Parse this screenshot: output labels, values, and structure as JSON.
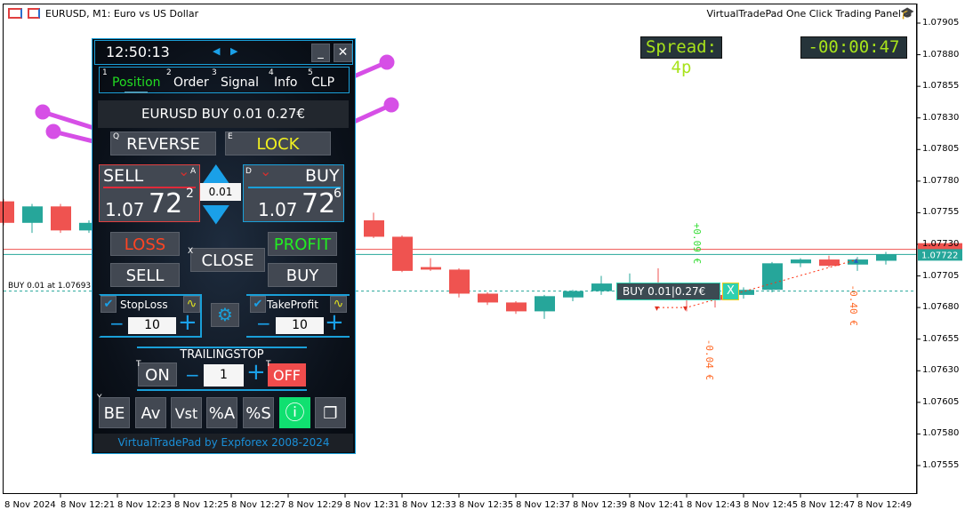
{
  "window": {
    "title": "EURUSD, M1:  Euro vs US Dollar",
    "panel_title": "VirtualTradePad One Click Trading Panel"
  },
  "indicators": {
    "spread": "Spread: 4p",
    "timer": "-00:00:47"
  },
  "colors": {
    "bull": "#26a69a",
    "bear": "#ef5350",
    "accent": "#1a9fd8",
    "lcd_text": "#a8e31b",
    "arrow": "#d64fe6"
  },
  "chart_data": {
    "type": "candlestick",
    "symbol": "EURUSD",
    "timeframe": "M1",
    "ylim": [
      1.07545,
      1.07915
    ],
    "price_ticks": [
      "1.07905",
      "1.07880",
      "1.07855",
      "1.07830",
      "1.07805",
      "1.07780",
      "1.07755",
      "1.07730",
      "1.07705",
      "1.07680",
      "1.07655",
      "1.07630",
      "1.07605",
      "1.07580",
      "1.07555"
    ],
    "time_ticks": [
      "8 Nov 2024",
      "8 Nov 12:21",
      "8 Nov 12:23",
      "8 Nov 12:25",
      "8 Nov 12:27",
      "8 Nov 12:29",
      "8 Nov 12:31",
      "8 Nov 12:33",
      "8 Nov 12:35",
      "8 Nov 12:37",
      "8 Nov 12:39",
      "8 Nov 12:41",
      "8 Nov 12:43",
      "8 Nov 12:45",
      "8 Nov 12:47",
      "8 Nov 12:49"
    ],
    "candles": [
      {
        "t": "12:19",
        "o": 1.07764,
        "h": 1.07766,
        "l": 1.07745,
        "c": 1.07747
      },
      {
        "t": "12:20",
        "o": 1.07747,
        "h": 1.07762,
        "l": 1.07739,
        "c": 1.0776
      },
      {
        "t": "12:21",
        "o": 1.0776,
        "h": 1.07762,
        "l": 1.07739,
        "c": 1.07741
      },
      {
        "t": "12:22",
        "o": 1.07741,
        "h": 1.07749,
        "l": 1.07739,
        "c": 1.07747
      },
      {
        "t": "12:32",
        "o": 1.07749,
        "h": 1.07755,
        "l": 1.07735,
        "c": 1.07736
      },
      {
        "t": "12:33",
        "o": 1.07736,
        "h": 1.07737,
        "l": 1.07708,
        "c": 1.07709
      },
      {
        "t": "12:34",
        "o": 1.07712,
        "h": 1.07719,
        "l": 1.07709,
        "c": 1.0771
      },
      {
        "t": "12:35",
        "o": 1.0771,
        "h": 1.07711,
        "l": 1.07688,
        "c": 1.07691
      },
      {
        "t": "12:36",
        "o": 1.07691,
        "h": 1.07692,
        "l": 1.07682,
        "c": 1.07684
      },
      {
        "t": "12:37",
        "o": 1.07684,
        "h": 1.07685,
        "l": 1.07675,
        "c": 1.07677
      },
      {
        "t": "12:38",
        "o": 1.07677,
        "h": 1.0769,
        "l": 1.07671,
        "c": 1.07689
      },
      {
        "t": "12:39",
        "o": 1.07688,
        "h": 1.07694,
        "l": 1.07685,
        "c": 1.07693
      },
      {
        "t": "12:40",
        "o": 1.07693,
        "h": 1.07705,
        "l": 1.0769,
        "c": 1.07699
      },
      {
        "t": "12:41",
        "o": 1.07696,
        "h": 1.07707,
        "l": 1.07692,
        "c": 1.07699
      },
      {
        "t": "12:42",
        "o": 1.07699,
        "h": 1.07711,
        "l": 1.07695,
        "c": 1.07697
      },
      {
        "t": "12:43",
        "o": 1.07697,
        "h": 1.07699,
        "l": 1.07677,
        "c": 1.0769
      },
      {
        "t": "12:44",
        "o": 1.0769,
        "h": 1.07694,
        "l": 1.0768,
        "c": 1.07686
      },
      {
        "t": "12:45",
        "o": 1.0769,
        "h": 1.07696,
        "l": 1.07687,
        "c": 1.07694
      },
      {
        "t": "12:46",
        "o": 1.07694,
        "h": 1.07716,
        "l": 1.07692,
        "c": 1.07715
      },
      {
        "t": "12:47",
        "o": 1.07715,
        "h": 1.07719,
        "l": 1.07712,
        "c": 1.07718
      },
      {
        "t": "12:48",
        "o": 1.07718,
        "h": 1.07721,
        "l": 1.07712,
        "c": 1.07713
      },
      {
        "t": "12:49",
        "o": 1.07714,
        "h": 1.0772,
        "l": 1.07709,
        "c": 1.07718
      },
      {
        "t": "12:50",
        "o": 1.07717,
        "h": 1.07724,
        "l": 1.07714,
        "c": 1.07722
      }
    ],
    "bid": 1.07722,
    "bid_label": "1.07722",
    "ask": 1.07726,
    "position_line": {
      "price": 1.07693,
      "label": "BUY 0.01 at 1.07693"
    },
    "annotations": [
      {
        "text": "+0.09 €",
        "t": "12:43",
        "price": 1.07747,
        "color": "#33dd33"
      },
      {
        "text": "-0.04 €",
        "t": "12:43",
        "price": 1.07655,
        "color": "#ff6622"
      },
      {
        "text": "-0.40 €",
        "t": "12:49",
        "price": 1.07698,
        "color": "#ff6622"
      }
    ],
    "trade_path": [
      {
        "t": "12:42",
        "price": 1.0768
      },
      {
        "t": "12:43",
        "price": 1.0768
      },
      {
        "t": "12:49",
        "price": 1.07718
      }
    ]
  },
  "trade_label": {
    "text": "BUY 0.01|0.27€",
    "close": "X"
  },
  "panel": {
    "time": "12:50:13",
    "minimize": "_",
    "close": "✕",
    "tabs": [
      {
        "num": "1",
        "label": "Position"
      },
      {
        "num": "2",
        "label": "Order"
      },
      {
        "num": "3",
        "label": "Signal"
      },
      {
        "num": "4",
        "label": "Info"
      },
      {
        "num": "5",
        "label": "CLP"
      }
    ],
    "summary": "EURUSD BUY 0.01 0.27€",
    "reverse": {
      "key": "Q",
      "label": "REVERSE"
    },
    "lock": {
      "key": "E",
      "label": "LOCK"
    },
    "sell": {
      "key": "A",
      "label": "SELL",
      "price_main": "1.07",
      "price_big": "72",
      "price_sup": "2"
    },
    "buy": {
      "key": "D",
      "label": "BUY",
      "price_main": "1.07",
      "price_big": "72",
      "price_sup": "6"
    },
    "lot": "0.01",
    "loss": "LOSS",
    "profit": "PROFIT",
    "close_all": {
      "key": "X",
      "label": "CLOSE"
    },
    "sell_btn": "SELL",
    "buy_btn": "BUY",
    "stoploss": {
      "label": "StopLoss",
      "value": "10",
      "checked": true
    },
    "takeprofit": {
      "label": "TakeProfit",
      "value": "10",
      "checked": true
    },
    "trailing": {
      "label": "TRAILINGSTOP",
      "on": "ON",
      "off": "OFF",
      "value": "1",
      "key_on": "T",
      "key_off": "T"
    },
    "bottom_key": "Y",
    "bottom": [
      "BE",
      "Av",
      "Vst",
      "%A",
      "%S"
    ],
    "footer": "VirtualTradePad by Expforex 2008-2024",
    "minus": "−",
    "plus": "+"
  }
}
